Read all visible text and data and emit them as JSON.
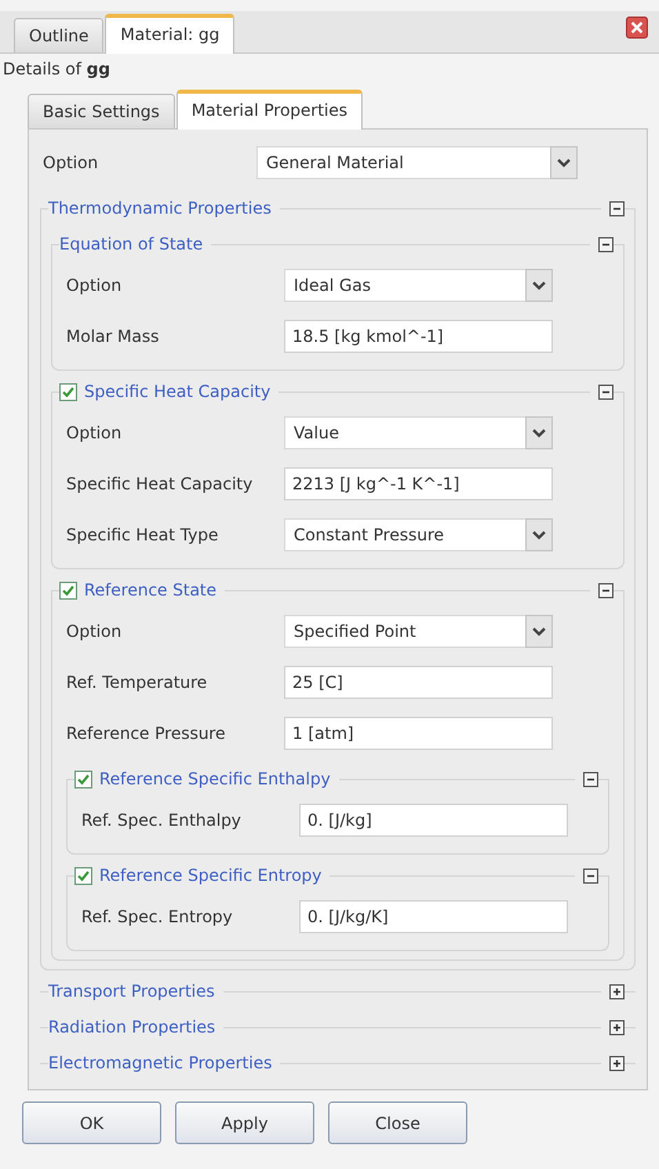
{
  "panel_tabs": [
    {
      "label": "Outline",
      "selected": false
    },
    {
      "label": "Material: gg",
      "selected": true
    }
  ],
  "details": "Details of **gg**",
  "tabs": [
    {
      "label": "Basic Settings",
      "selected": false
    },
    {
      "label": "Material Properties",
      "selected": true
    }
  ],
  "option": {
    "label": "Option",
    "value": "General Material"
  },
  "sections": [
    {
      "title": "Thermodynamic Properties",
      "expanded": true,
      "children": [
        {
          "title": "Equation of State",
          "expanded": true,
          "rows": [
            {
              "kind": "dropdown",
              "label": "Option",
              "value": "Ideal Gas"
            },
            {
              "kind": "text",
              "label": "Molar Mass",
              "value": "18.5 [kg kmol^-1]"
            }
          ]
        },
        {
          "title": "Specific Heat Capacity",
          "checked": true,
          "expanded": true,
          "rows": [
            {
              "kind": "dropdown",
              "label": "Option",
              "value": "Value"
            },
            {
              "kind": "text",
              "label": "Specific Heat Capacity",
              "value": "2213 [J kg^-1 K^-1]"
            },
            {
              "kind": "dropdown",
              "label": "Specific Heat Type",
              "value": "Constant Pressure"
            }
          ]
        },
        {
          "title": "Reference State",
          "checked": true,
          "expanded": true,
          "rows": [
            {
              "kind": "dropdown",
              "label": "Option",
              "value": "Specified Point"
            },
            {
              "kind": "text",
              "label": "Ref. Temperature",
              "value": "25 [C]"
            },
            {
              "kind": "text",
              "label": "Reference Pressure",
              "value": "1 [atm]"
            }
          ],
          "children": [
            {
              "title": "Reference Specific Enthalpy",
              "checked": true,
              "expanded": true,
              "rows": [
                {
                  "kind": "text",
                  "label": "Ref. Spec. Enthalpy",
                  "value": "0. [J/kg]"
                }
              ]
            },
            {
              "title": "Reference Specific Entropy",
              "checked": true,
              "expanded": true,
              "rows": [
                {
                  "kind": "text",
                  "label": "Ref. Spec. Entropy",
                  "value": "0. [J/kg/K]"
                }
              ]
            }
          ]
        }
      ]
    },
    {
      "title": "Transport Properties",
      "expanded": false
    },
    {
      "title": "Radiation Properties",
      "expanded": false
    },
    {
      "title": "Electromagnetic Properties",
      "expanded": false
    }
  ],
  "buttons": [
    "OK",
    "Apply",
    "Close"
  ]
}
